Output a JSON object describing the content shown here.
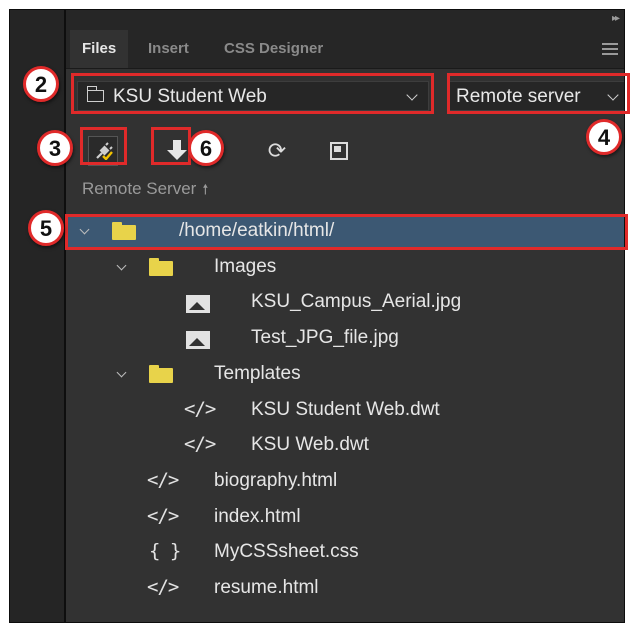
{
  "tabs": [
    {
      "label": "Files",
      "active": true
    },
    {
      "label": "Insert",
      "active": false
    },
    {
      "label": "CSS Designer",
      "active": false
    }
  ],
  "site_select": {
    "value": "KSU Student Web",
    "icon": "folder-outline-icon"
  },
  "server_select": {
    "value": "Remote server"
  },
  "toolbar": {
    "icons": [
      "connect-plug-icon",
      "get-download-icon",
      "refresh-icon",
      "expand-view-icon"
    ]
  },
  "root_label": "Remote Server",
  "tree": [
    {
      "name": "/home/eatkin/html/",
      "type": "folder",
      "level": 0,
      "expanded": true,
      "selected": true
    },
    {
      "name": "Images",
      "type": "folder",
      "level": 1,
      "expanded": true
    },
    {
      "name": "KSU_Campus_Aerial.jpg",
      "type": "image",
      "level": 2
    },
    {
      "name": "Test_JPG_file.jpg",
      "type": "image",
      "level": 2
    },
    {
      "name": "Templates",
      "type": "folder",
      "level": 1,
      "expanded": true
    },
    {
      "name": "KSU Student Web.dwt",
      "type": "code",
      "level": 2
    },
    {
      "name": "KSU Web.dwt",
      "type": "code",
      "level": 2
    },
    {
      "name": "biography.html",
      "type": "code",
      "level": 1
    },
    {
      "name": "index.html",
      "type": "code",
      "level": 1
    },
    {
      "name": "MyCSSsheet.css",
      "type": "css",
      "level": 1
    },
    {
      "name": "resume.html",
      "type": "code",
      "level": 1
    }
  ],
  "callouts": [
    "2",
    "3",
    "4",
    "5",
    "6"
  ],
  "colors": {
    "highlight": "#e02a2a",
    "selection": "#3c5873",
    "folder": "#e8d34a",
    "panel": "#323232"
  }
}
